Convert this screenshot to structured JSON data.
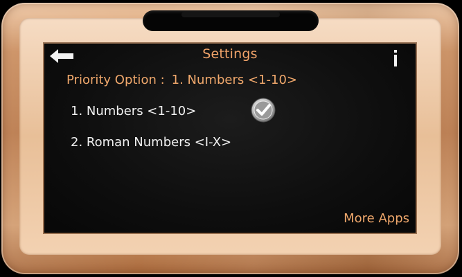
{
  "header": {
    "title": "Settings",
    "back_icon": "back-arrow-icon",
    "info_icon": "info-icon"
  },
  "priority": {
    "label": "Priority Option :",
    "value": "1. Numbers <1-10>"
  },
  "options": [
    {
      "label": "1. Numbers <1-10>",
      "selected": true
    },
    {
      "label": "2. Roman Numbers <I-X>",
      "selected": false
    }
  ],
  "footer": {
    "more_apps": "More Apps"
  },
  "colors": {
    "accent_orange": "#f0a86c",
    "text_white": "#f1f1f1",
    "screen_black": "#0e0e0e",
    "wood": "#c98b5b"
  }
}
